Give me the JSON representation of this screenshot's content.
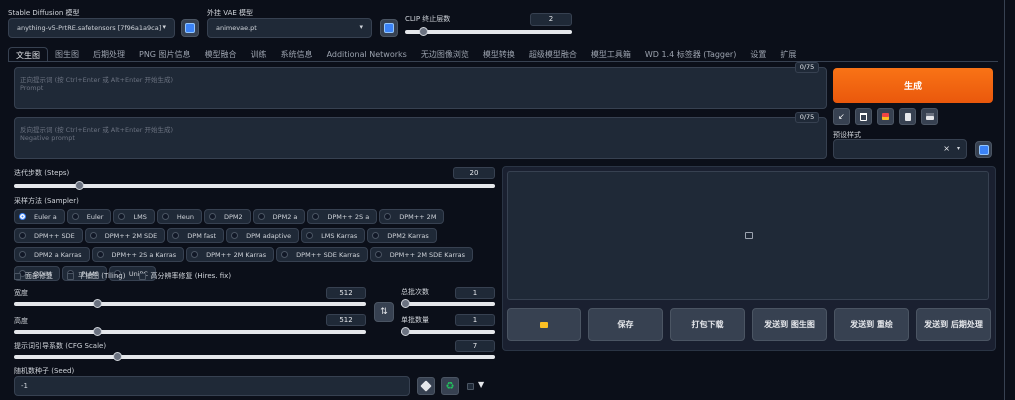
{
  "header": {
    "model_label": "Stable Diffusion 模型",
    "model_value": "anything-v5-PrtRE.safetensors [7f96a1a9ca]",
    "vae_label": "外挂 VAE 模型",
    "vae_value": "animevae.pt",
    "clip_label": "CLIP 终止层数",
    "clip_value": "2",
    "clip_fraction": 0.09
  },
  "tabs": [
    "文生图",
    "图生图",
    "后期处理",
    "PNG 图片信息",
    "模型融合",
    "训练",
    "系统信息",
    "Additional Networks",
    "无边图像浏览",
    "模型转换",
    "超级模型融合",
    "模型工具箱",
    "WD 1.4 标签器 (Tagger)",
    "设置",
    "扩展"
  ],
  "prompt": {
    "placeholder_line1": "正向提示词 (按 Ctrl+Enter 或 Alt+Enter 开始生成)",
    "placeholder_line2": "Prompt",
    "counter": "0/75"
  },
  "negative": {
    "placeholder_line1": "反向提示词 (按 Ctrl+Enter 或 Alt+Enter 开始生成)",
    "placeholder_line2": "Negative prompt",
    "counter": "0/75"
  },
  "generate_label": "生成",
  "styles_label": "预设样式",
  "steps": {
    "label": "迭代步数 (Steps)",
    "value": "20",
    "fraction": 0.13
  },
  "sampler": {
    "label": "采样方法 (Sampler)",
    "selected": "Euler a",
    "options": [
      "Euler a",
      "Euler",
      "LMS",
      "Heun",
      "DPM2",
      "DPM2 a",
      "DPM++ 2S a",
      "DPM++ 2M",
      "DPM++ SDE",
      "DPM++ 2M SDE",
      "DPM fast",
      "DPM adaptive",
      "LMS Karras",
      "DPM2 Karras",
      "DPM2 a Karras",
      "DPM++ 2S a Karras",
      "DPM++ 2M Karras",
      "DPM++ SDE Karras",
      "DPM++ 2M SDE Karras",
      "DDIM",
      "PLMS",
      "UniPC"
    ]
  },
  "checkboxes": [
    "面部修复",
    "平铺图 (Tiling)",
    "高分辨率修复 (Hires. fix)"
  ],
  "width": {
    "label": "宽度",
    "value": "512",
    "fraction": 0.23
  },
  "height": {
    "label": "高度",
    "value": "512",
    "fraction": 0.23
  },
  "batch_count": {
    "label": "总批次数",
    "value": "1",
    "fraction": 0.0
  },
  "batch_size": {
    "label": "单批数量",
    "value": "1",
    "fraction": 0.0
  },
  "cfg": {
    "label": "提示词引导系数 (CFG Scale)",
    "value": "7",
    "fraction": 0.21
  },
  "seed": {
    "label": "随机数种子 (Seed)",
    "value": "-1"
  },
  "actions": [
    "保存",
    "打包下载",
    "发送到 图生图",
    "发送到 重绘",
    "发送到 后期处理"
  ]
}
